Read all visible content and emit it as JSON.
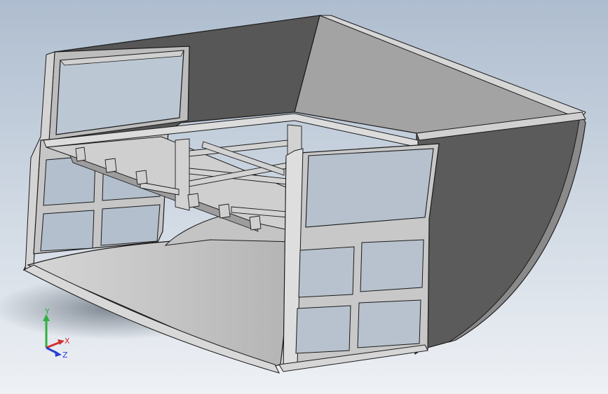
{
  "viewport": {
    "background_top": "#aebdcf",
    "background_bottom": "#e9edf2"
  },
  "model": {
    "part": "structural-bucket-frame",
    "colors": {
      "light": "#cfcfcf",
      "mid": "#bdbdbd",
      "dark": "#5a5a5a",
      "darker": "#4c4c4c",
      "edge": "#1a1a1a",
      "shadow": "#7f8790"
    }
  },
  "triad": {
    "x_label": "X",
    "y_label": "Y",
    "z_label": "Z",
    "x_color": "#d03030",
    "y_color": "#2fb040",
    "z_color": "#2a3fd0"
  }
}
